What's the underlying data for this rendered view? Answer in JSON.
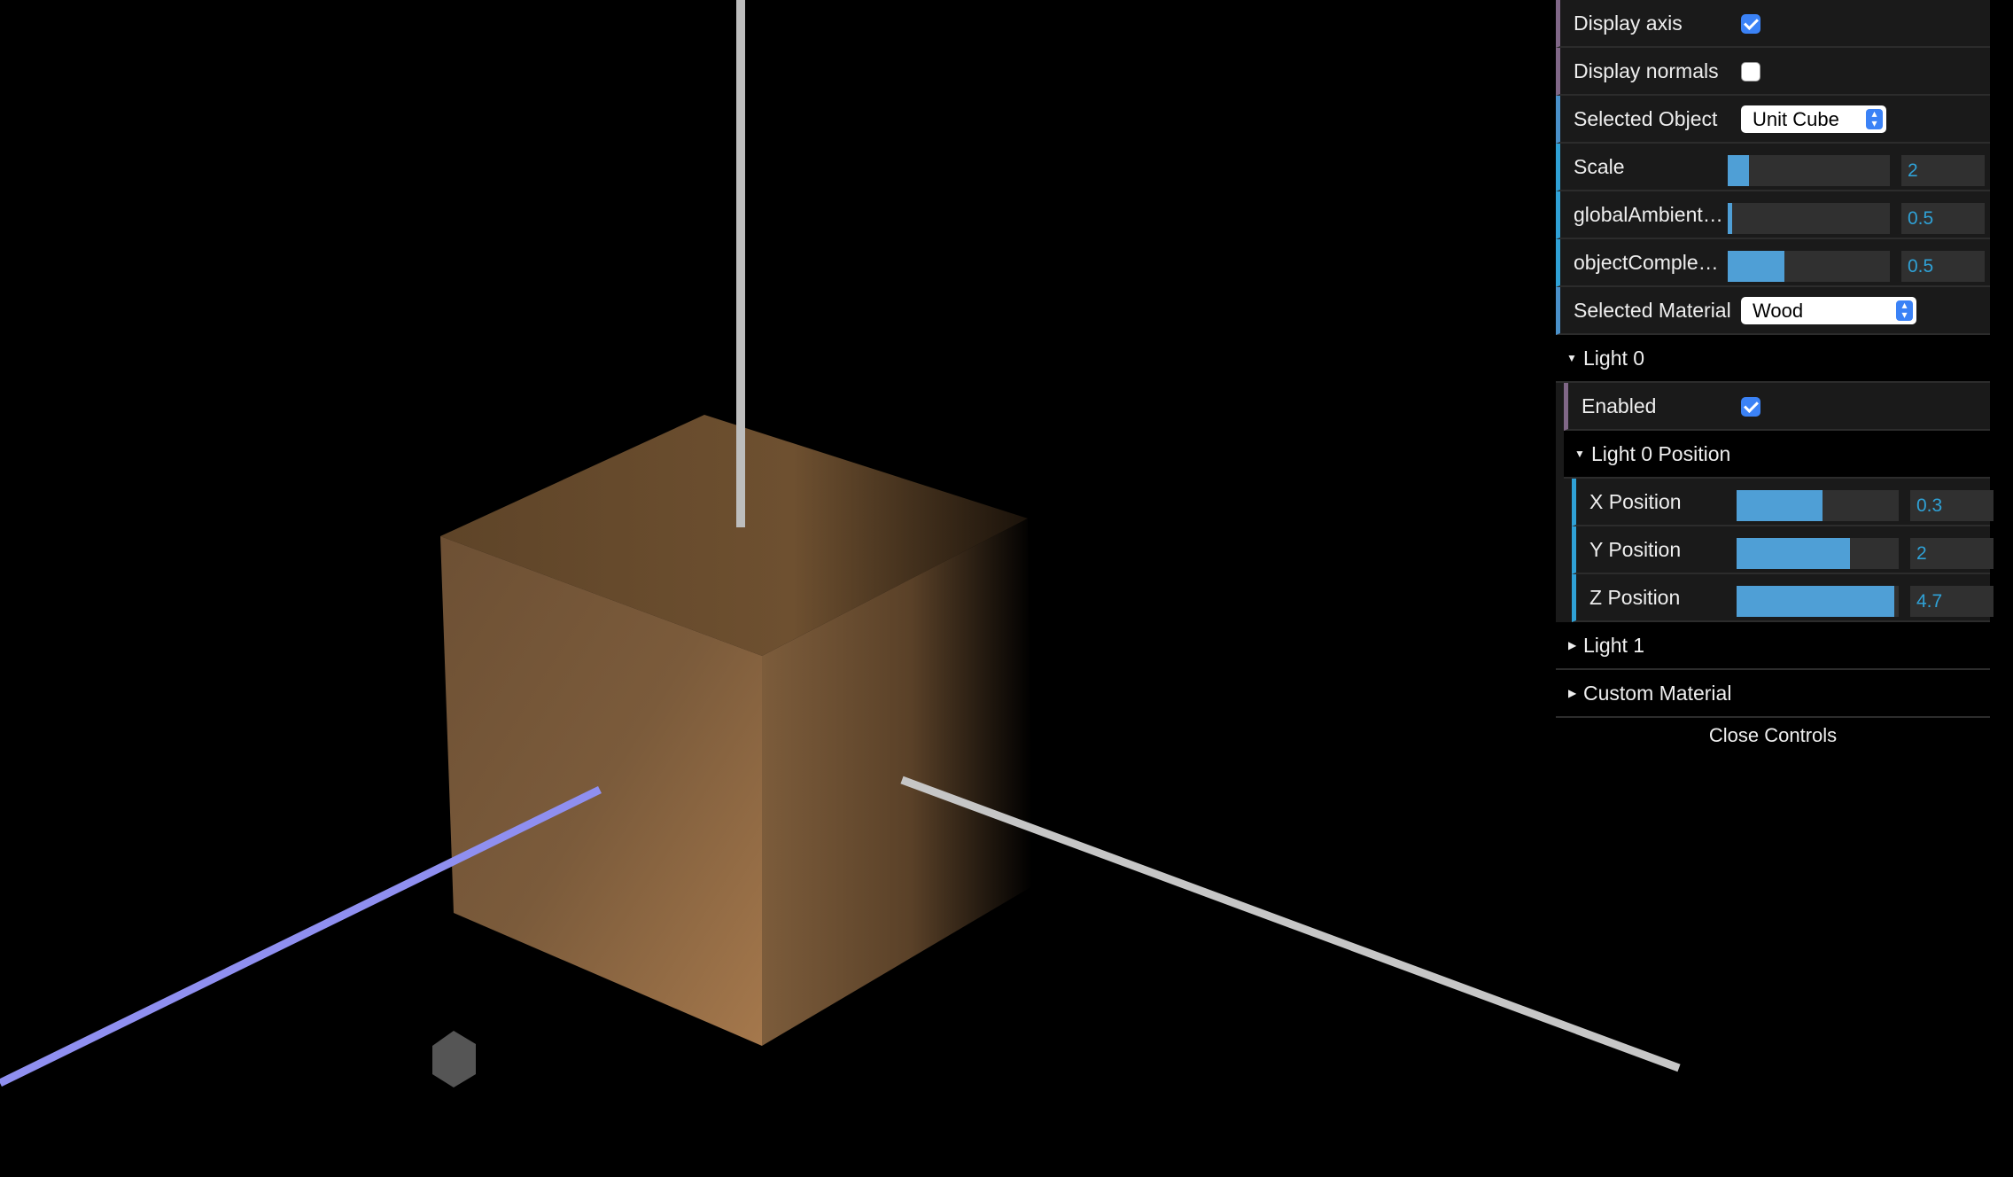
{
  "scene": {
    "object_color": "#7a5a3a",
    "x_axis_color": "#8f8ff0",
    "y_axis_color": "#bfbfbf",
    "z_axis_color": "#c8c8c8"
  },
  "controls": {
    "display_axis": {
      "label": "Display axis",
      "checked": true
    },
    "display_normals": {
      "label": "Display normals",
      "checked": false
    },
    "selected_object": {
      "label": "Selected Object",
      "value": "Unit Cube"
    },
    "scale": {
      "label": "Scale",
      "value": "2",
      "fraction": 0.13
    },
    "global_ambient": {
      "label": "globalAmbient…",
      "value": "0.5",
      "fraction": 0.03
    },
    "object_complexity": {
      "label": "objectComplex…",
      "value": "0.5",
      "fraction": 0.35
    },
    "selected_material": {
      "label": "Selected Material",
      "value": "Wood"
    },
    "light0": {
      "title": "Light 0",
      "enabled": {
        "label": "Enabled",
        "checked": true
      },
      "position": {
        "title": "Light 0 Position",
        "x": {
          "label": "X Position",
          "value": "0.3",
          "fraction": 0.53
        },
        "y": {
          "label": "Y Position",
          "value": "2",
          "fraction": 0.7
        },
        "z": {
          "label": "Z Position",
          "value": "4.7",
          "fraction": 0.97
        }
      }
    },
    "light1": {
      "title": "Light 1"
    },
    "custom_material": {
      "title": "Custom Material"
    },
    "close_label": "Close Controls"
  }
}
